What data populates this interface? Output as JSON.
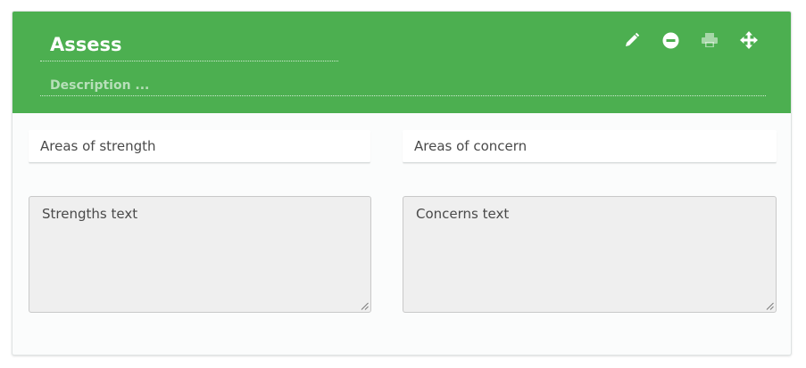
{
  "panel": {
    "title": "Assess",
    "description_placeholder": "Description ...",
    "header_color": "#4caf50"
  },
  "toolbar": {
    "icons": [
      "pencil-icon",
      "minus-circle-icon",
      "print-icon",
      "move-icon"
    ],
    "print_disabled": true
  },
  "strengths": {
    "label": "Areas of strength",
    "text": "Strengths text"
  },
  "concerns": {
    "label": "Areas of concern",
    "text": "Concerns text"
  }
}
